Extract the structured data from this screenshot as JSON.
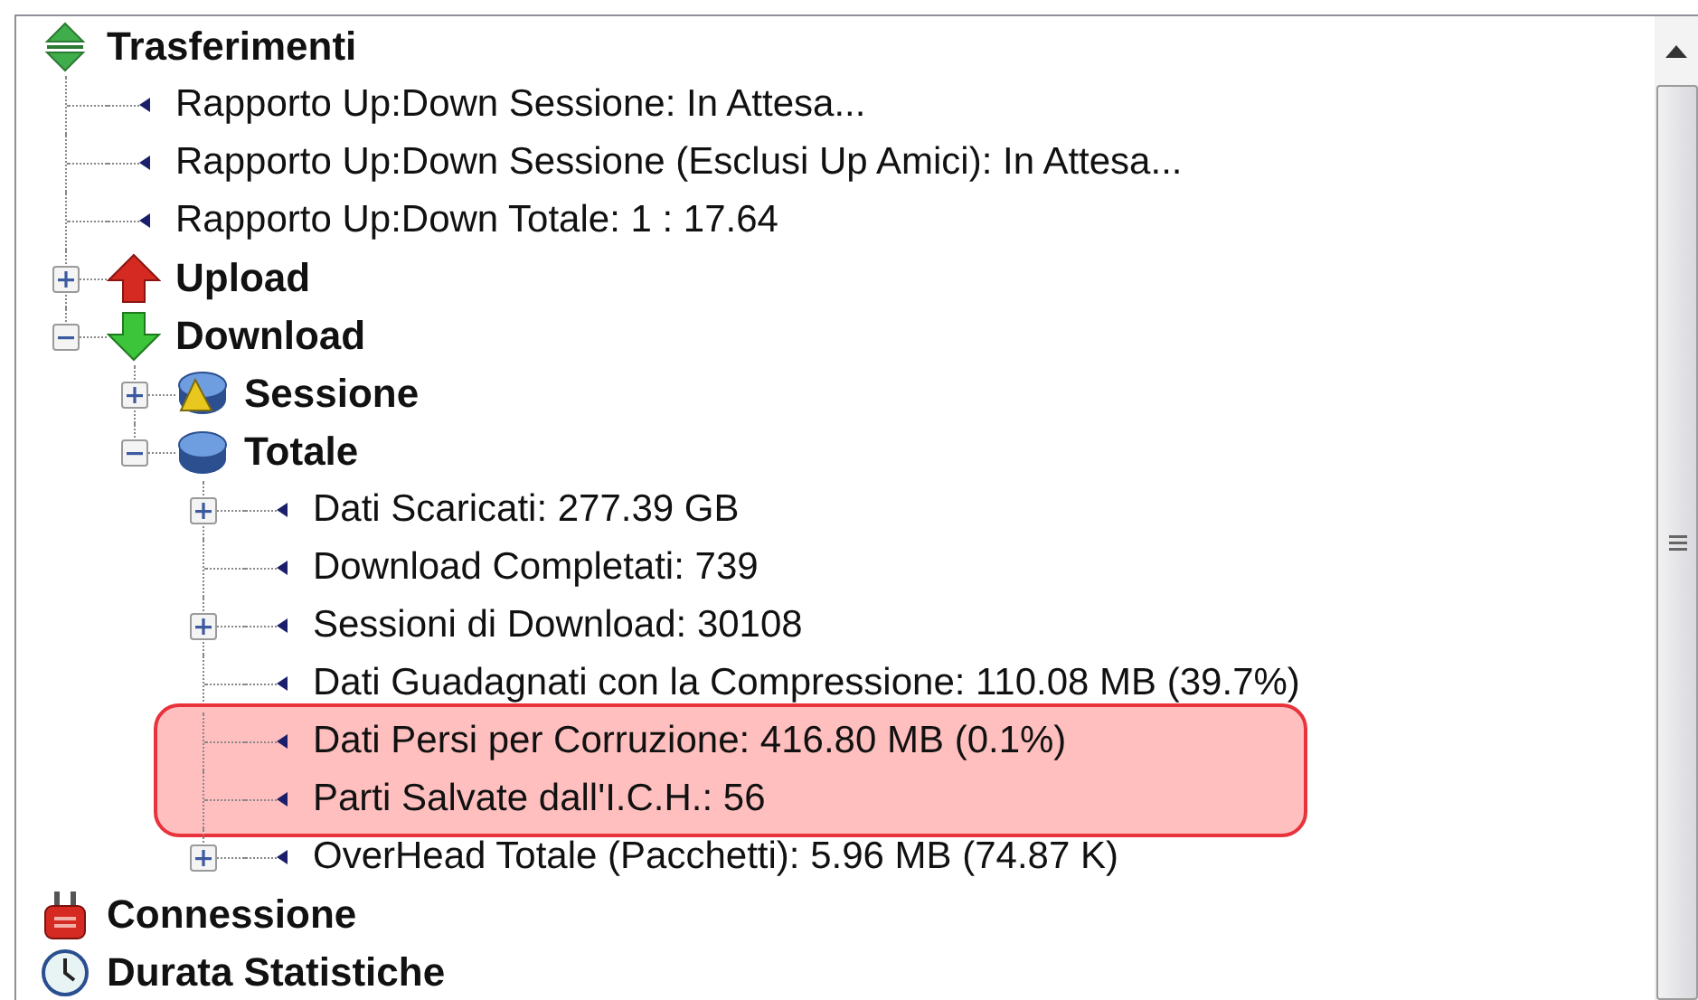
{
  "tree": [
    {
      "kind": "transfers",
      "label": "Trasferimenti",
      "children": [
        {
          "kind": "stat",
          "label": "Rapporto Up:Down Sessione: In Attesa..."
        },
        {
          "kind": "stat",
          "label": "Rapporto Up:Down Sessione (Esclusi Up Amici): In Attesa..."
        },
        {
          "kind": "stat",
          "label": "Rapporto Up:Down Totale: 1 : 17.64"
        },
        {
          "kind": "upload",
          "label": "Upload",
          "expanded": false
        },
        {
          "kind": "download",
          "label": "Download",
          "expanded": true,
          "children": [
            {
              "kind": "session",
              "label": "Sessione",
              "expanded": false
            },
            {
              "kind": "total",
              "label": "Totale",
              "expanded": true,
              "children": [
                {
                  "kind": "stat",
                  "label": "Dati Scaricati: 277.39 GB",
                  "expanded": false,
                  "highlighted": false
                },
                {
                  "kind": "stat",
                  "label": "Download Completati: 739",
                  "highlighted": false
                },
                {
                  "kind": "stat",
                  "label": "Sessioni di Download: 30108",
                  "expanded": false,
                  "highlighted": false
                },
                {
                  "kind": "stat",
                  "label": "Dati Guadagnati con la Compressione: 110.08 MB (39.7%)",
                  "highlighted": false
                },
                {
                  "kind": "stat",
                  "label": "Dati Persi per Corruzione: 416.80 MB (0.1%)",
                  "highlighted": true
                },
                {
                  "kind": "stat",
                  "label": "Parti Salvate dall'I.C.H.: 56",
                  "highlighted": true
                },
                {
                  "kind": "stat",
                  "label": "OverHead Totale (Pacchetti): 5.96 MB (74.87 K)",
                  "expanded": false,
                  "highlighted": false
                }
              ]
            }
          ]
        }
      ]
    },
    {
      "kind": "connection",
      "label": "Connessione"
    },
    {
      "kind": "duration",
      "label": "Durata Statistiche"
    }
  ]
}
